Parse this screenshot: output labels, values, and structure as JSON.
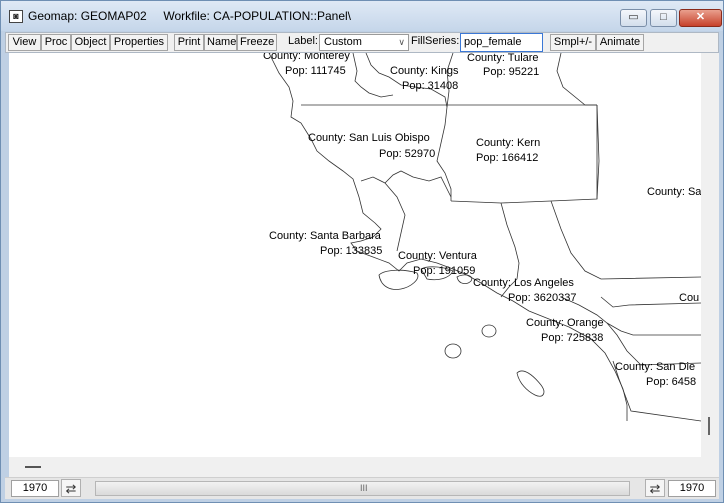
{
  "window": {
    "title": "Geomap: GEOMAP02     Workfile: CA-POPULATION::Panel\\",
    "controls": {
      "minimize": "▭",
      "maximize": "□",
      "close": "✕"
    }
  },
  "toolbar": {
    "view": "View",
    "proc": "Proc",
    "object": "Object",
    "properties": "Properties",
    "print": "Print",
    "name": "Name",
    "freeze": "Freeze",
    "label_caption": "Label:",
    "label_value": "Custom",
    "fillseries_caption": "FillSeries:",
    "fillseries_value": "pop_female",
    "smpl": "Smpl+/-",
    "animate": "Animate"
  },
  "map": {
    "labels": [
      {
        "county": "County: Monterey",
        "pop": "Pop: 111745"
      },
      {
        "county": "County: Kings",
        "pop": "Pop: 31408"
      },
      {
        "county": "County: Tulare",
        "pop": "Pop: 95221"
      },
      {
        "county": "County: San Luis Obispo",
        "pop": "Pop: 52970"
      },
      {
        "county": "County: Kern",
        "pop": "Pop: 166412"
      },
      {
        "county": "County: Sa",
        "pop": ""
      },
      {
        "county": "County: Santa Barbara",
        "pop": "Pop: 133835"
      },
      {
        "county": "County: Ventura",
        "pop": "Pop: 191059"
      },
      {
        "county": "County: Los Angeles",
        "pop": "Pop: 3620337"
      },
      {
        "county": "Cou",
        "pop": ""
      },
      {
        "county": "County: Orange",
        "pop": "Pop: 725838"
      },
      {
        "county": "County: San Die",
        "pop": "Pop: 6458"
      }
    ]
  },
  "slider": {
    "start_year": "1970",
    "end_year": "1970",
    "grip": "III",
    "swap_icon": "⇄"
  }
}
